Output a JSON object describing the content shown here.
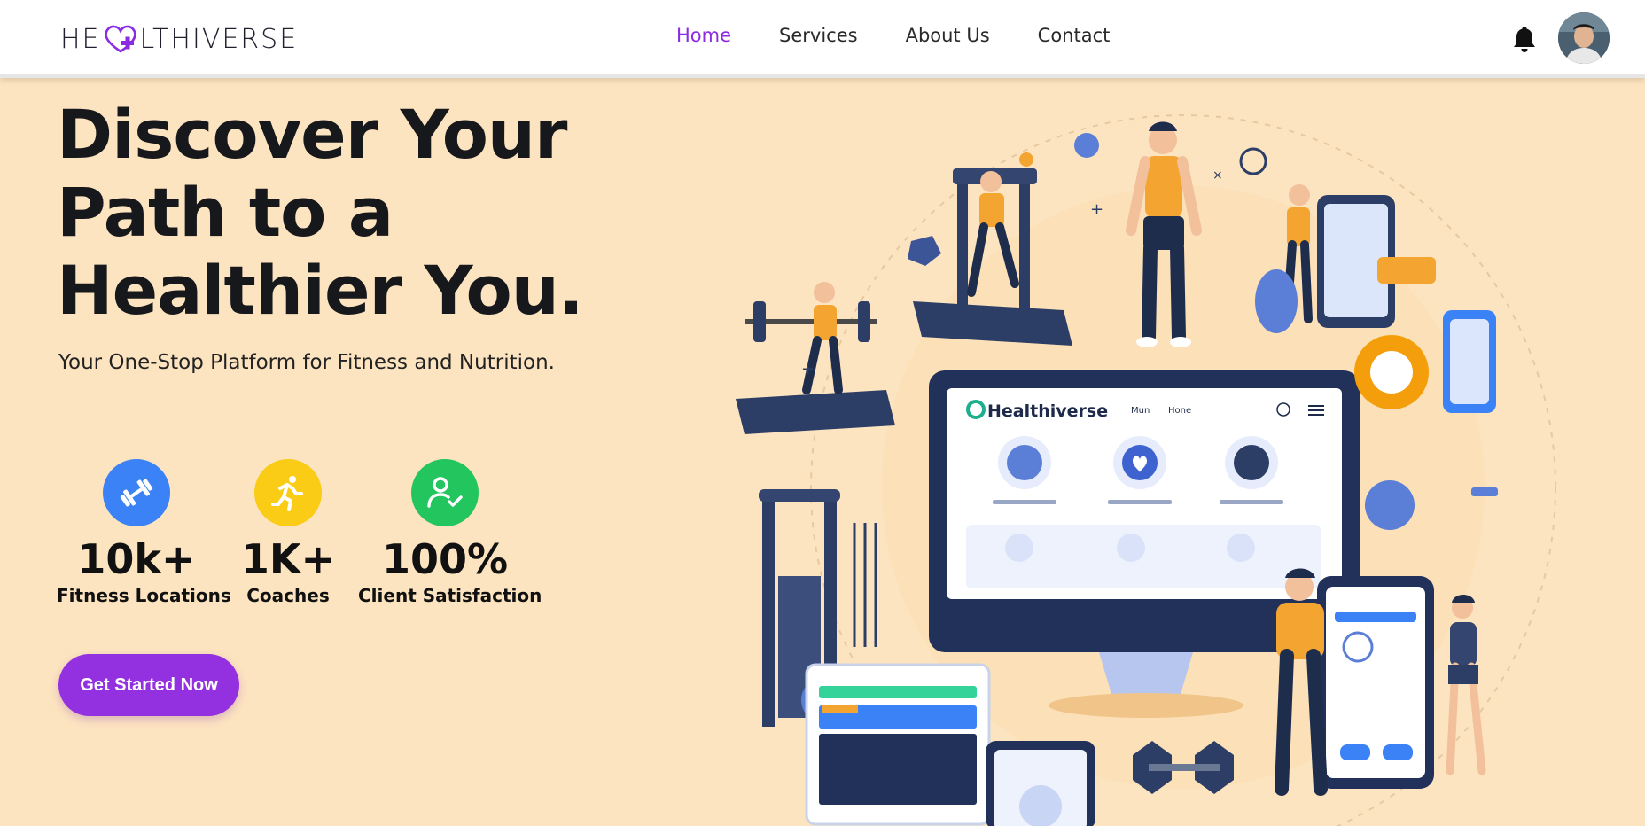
{
  "nav": {
    "logo_text_start": "HE",
    "logo_text_end": "LTHIVERSE",
    "links": [
      {
        "label": "Home",
        "active": true
      },
      {
        "label": "Services",
        "active": false
      },
      {
        "label": "About Us",
        "active": false
      },
      {
        "label": "Contact",
        "active": false
      }
    ],
    "icons": {
      "notifications": "bell-icon",
      "profile": "avatar"
    }
  },
  "hero": {
    "title_line1": "Discover Your",
    "title_line2": "Path to a",
    "title_line3": "Healthier You.",
    "subtitle": "Your One-Stop Platform for Fitness and Nutrition.",
    "cta_label": "Get Started Now"
  },
  "stats": [
    {
      "value": "10k+",
      "label": "Fitness Locations",
      "icon": "dumbbell-icon",
      "color": "#3b82f6"
    },
    {
      "value": "1K+",
      "label": "Coaches",
      "icon": "runner-icon",
      "color": "#facc15"
    },
    {
      "value": "100%",
      "label": "Client Satisfaction",
      "icon": "user-check-icon",
      "color": "#22c55e"
    }
  ],
  "illustration": {
    "app_brand": "Healthiverse",
    "app_nav": [
      "Mun",
      "Hone"
    ]
  },
  "colors": {
    "accent": "#8b2be2",
    "background": "#fde4c0",
    "cta": "#9330e0"
  }
}
